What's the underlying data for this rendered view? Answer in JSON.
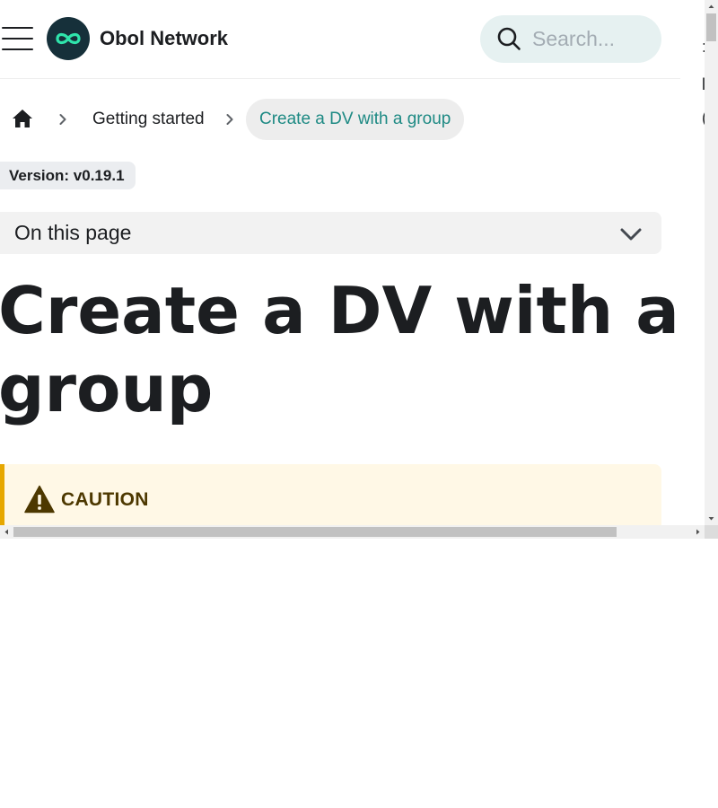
{
  "navbar": {
    "brand_name": "Obol Network",
    "logo_icon": "obol-infinity-logo-icon",
    "menu_icon": "hamburger-menu-icon",
    "search": {
      "placeholder": "Search...",
      "value": "",
      "icon": "search-icon"
    }
  },
  "breadcrumbs": {
    "home_icon": "home-icon",
    "items": [
      {
        "label": "Getting started"
      },
      {
        "label": "Create a DV with a group"
      }
    ]
  },
  "version_badge": "Version: v0.19.1",
  "toc": {
    "label": "On this page",
    "icon": "chevron-down-icon"
  },
  "page": {
    "title": "Create a DV with a group"
  },
  "admonition": {
    "type_label": "CAUTION",
    "icon": "warning-triangle-icon"
  },
  "colors": {
    "accent": "#1e8a84",
    "search_bg": "#e6f1f1",
    "caution_border": "#e6a700",
    "caution_bg": "#fff8e6",
    "caution_text": "#4d3800",
    "logo_bg": "#16303a",
    "logo_stroke": "#2fe4ab"
  }
}
